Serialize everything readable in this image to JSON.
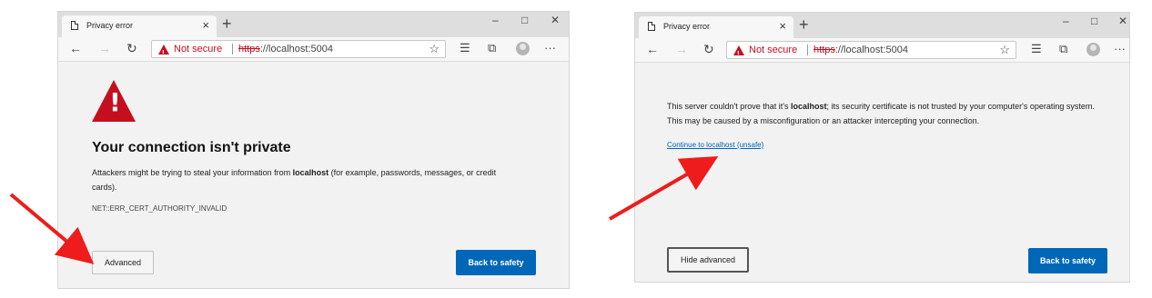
{
  "left_window": {
    "tab_title": "Privacy error",
    "tab_close": "×",
    "new_tab": "+",
    "window_controls": {
      "minimize": "–",
      "maximize": "□",
      "close": "✕"
    },
    "nav": {
      "back": "←",
      "forward": "→",
      "refresh": "↻"
    },
    "address": {
      "security_label": "Not secure",
      "url_scheme": "https",
      "url_rest": "://localhost:5004",
      "favorite": "☆"
    },
    "toolbar_icons": {
      "favorites": "☰",
      "collections": "⧉",
      "menu": "···"
    },
    "content": {
      "heading": "Your connection isn't private",
      "description_before": "Attackers might be trying to steal your information from ",
      "description_host": "localhost",
      "description_after": " (for example, passwords, messages, or credit cards).",
      "error_code": "NET::ERR_CERT_AUTHORITY_INVALID",
      "advanced_button": "Advanced",
      "back_button": "Back to safety"
    }
  },
  "right_window": {
    "tab_title": "Privacy error",
    "tab_close": "×",
    "new_tab": "+",
    "window_controls": {
      "minimize": "–",
      "maximize": "□",
      "close": "✕"
    },
    "nav": {
      "back": "←",
      "forward": "→",
      "refresh": "↻"
    },
    "address": {
      "security_label": "Not secure",
      "url_scheme": "https",
      "url_rest": "://localhost:5004",
      "favorite": "☆"
    },
    "toolbar_icons": {
      "favorites": "☰",
      "collections": "⧉",
      "menu": "···"
    },
    "content": {
      "description_before": "This server couldn't prove that it's ",
      "description_host": "localhost",
      "description_after": "; its security certificate is not trusted by your computer's operating system. This may be caused by a misconfiguration or an attacker intercepting your connection.",
      "proceed_link": "Continue to localhost (unsafe)",
      "hide_advanced_button": "Hide advanced",
      "back_button": "Back to safety"
    }
  },
  "colors": {
    "warning_red": "#c50f1f",
    "primary_blue": "#0067b8",
    "arrow_red": "#ee1c1c"
  }
}
